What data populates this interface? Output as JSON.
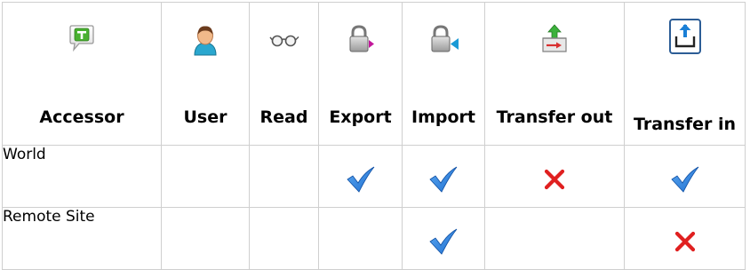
{
  "columns": [
    {
      "key": "accessor",
      "label": "Accessor",
      "icon": "speech-bubble-t-icon"
    },
    {
      "key": "user",
      "label": "User",
      "icon": "user-icon"
    },
    {
      "key": "read",
      "label": "Read",
      "icon": "glasses-icon"
    },
    {
      "key": "export",
      "label": "Export",
      "icon": "lock-export-icon"
    },
    {
      "key": "import",
      "label": "Import",
      "icon": "lock-import-icon"
    },
    {
      "key": "transfer_out",
      "label": "Transfer out",
      "icon": "transfer-out-icon"
    },
    {
      "key": "transfer_in",
      "label": "Transfer in",
      "icon": "transfer-in-icon"
    }
  ],
  "rows": [
    {
      "accessor": "World",
      "user": "",
      "read": "",
      "export": "check",
      "import": "check",
      "transfer_out": "cross",
      "transfer_in": "check"
    },
    {
      "accessor": "Remote Site",
      "user": "",
      "read": "",
      "export": "",
      "import": "check",
      "transfer_out": "",
      "transfer_in": "cross"
    }
  ],
  "colors": {
    "border": "#cfcfcf",
    "check": "#1f6fd0",
    "cross": "#e02020",
    "text": "#000000"
  }
}
